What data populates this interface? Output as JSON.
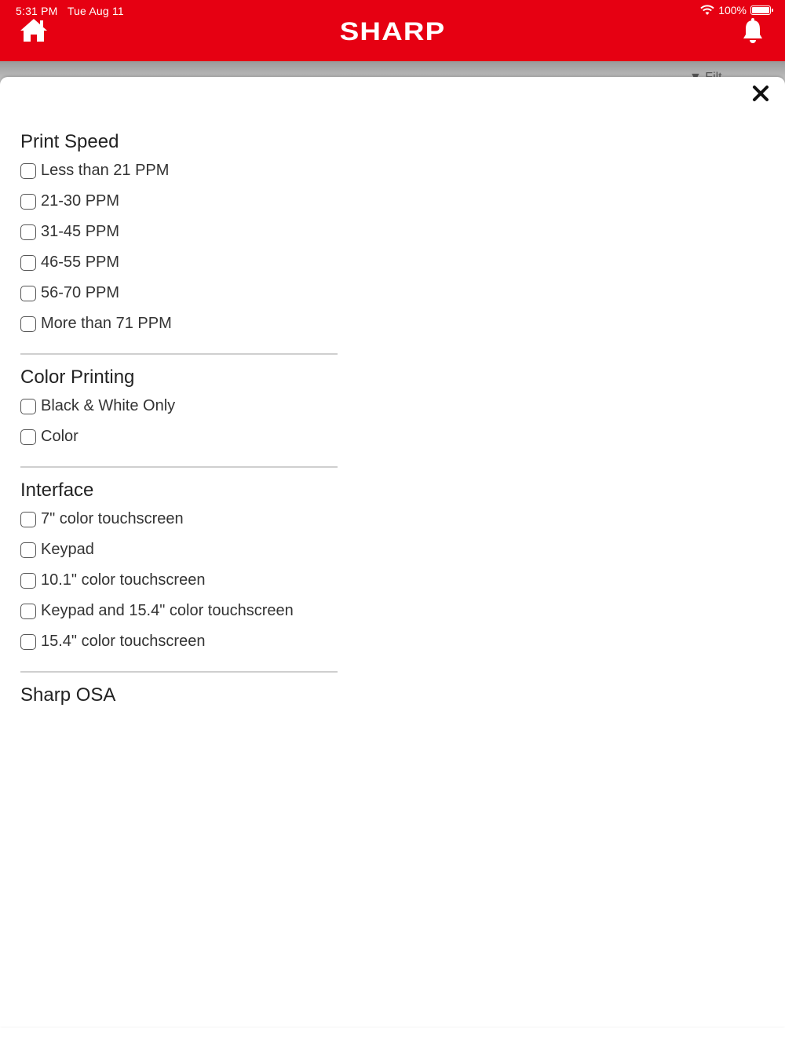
{
  "status_bar": {
    "time": "5:31 PM",
    "date": "Tue Aug 11",
    "battery": "100%"
  },
  "header": {
    "brand": "SHARP",
    "home_icon": "home-icon",
    "notification_icon": "bell-icon",
    "color": "#e60012"
  },
  "background_page": {
    "filter_label_partial": "Filt"
  },
  "filter_sheet": {
    "close_icon": "close-icon",
    "groups": [
      {
        "title": "Print Speed",
        "options": [
          "Less than 21 PPM",
          "21-30 PPM",
          "31-45 PPM",
          "46-55 PPM",
          "56-70 PPM",
          "More than 71 PPM"
        ]
      },
      {
        "title": "Color Printing",
        "options": [
          "Black & White Only",
          "Color"
        ]
      },
      {
        "title": "Interface",
        "options": [
          "7\" color touchscreen",
          "Keypad",
          "10.1\" color touchscreen",
          "Keypad and 15.4\" color touchscreen",
          "15.4\" color touchscreen"
        ]
      },
      {
        "title": "Sharp OSA",
        "options": []
      }
    ]
  }
}
